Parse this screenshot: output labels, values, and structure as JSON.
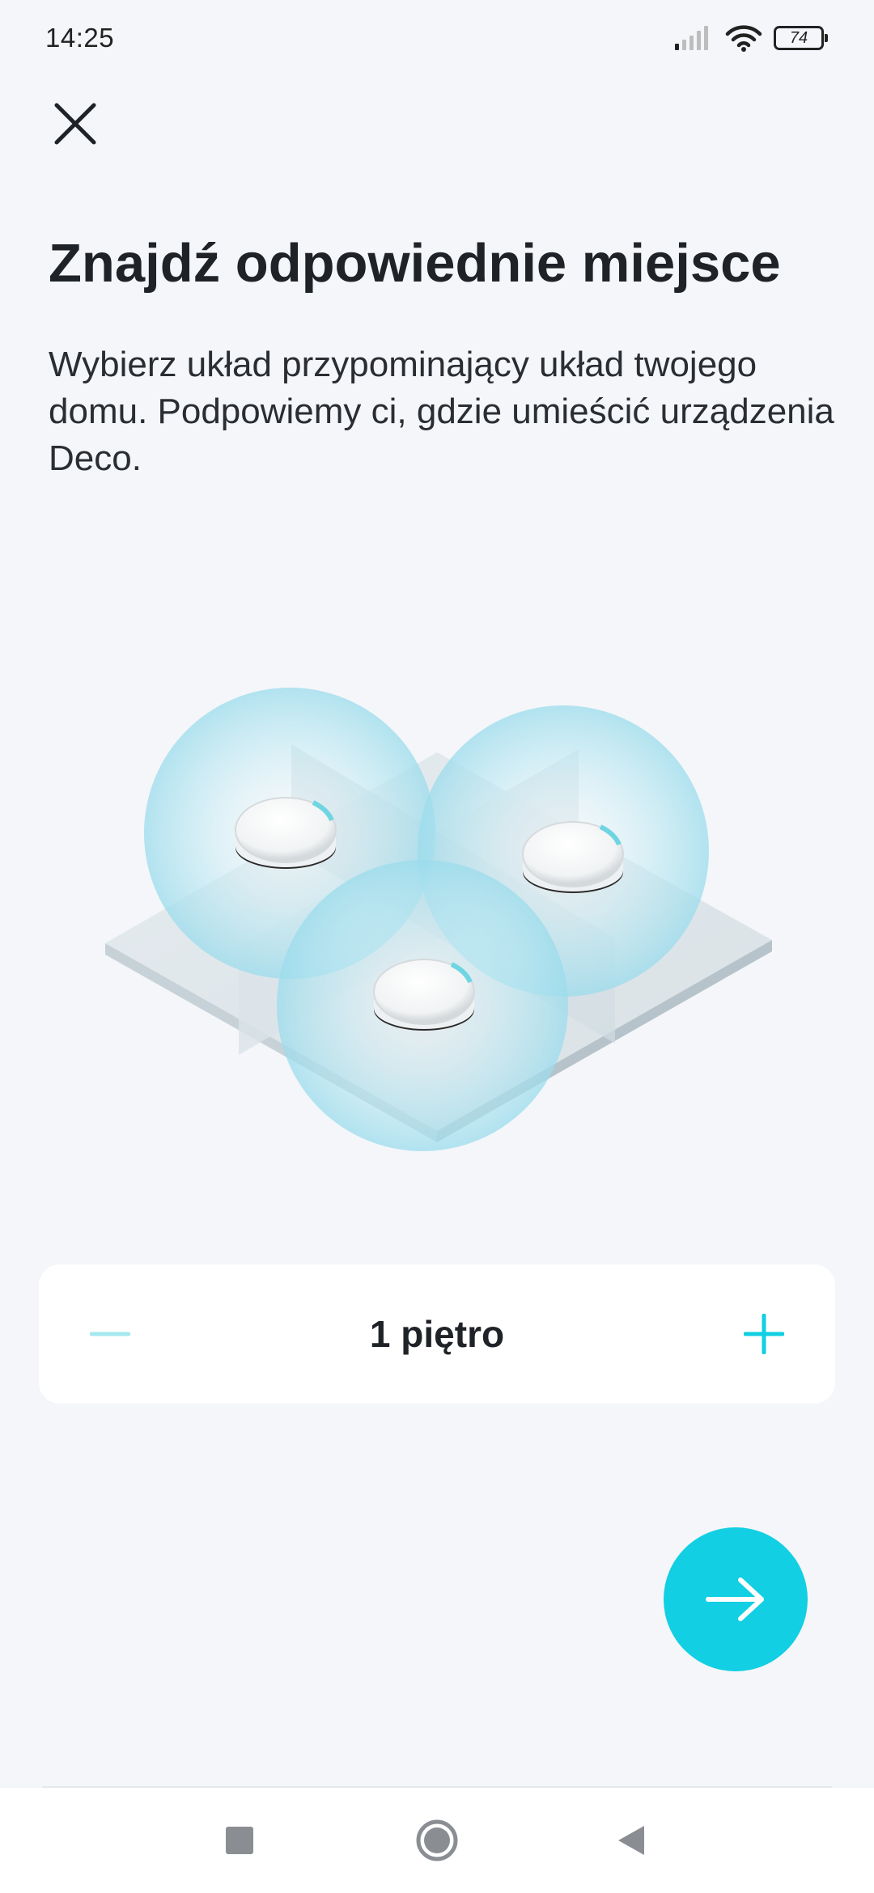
{
  "status_bar": {
    "time": "14:25",
    "battery_level": "74",
    "icons": [
      "signal-icon",
      "wifi-icon",
      "battery-icon"
    ]
  },
  "header": {
    "close_icon": "close-icon"
  },
  "main": {
    "title": "Znajdź odpowiednie miejsce",
    "description": "Wybierz układ przypominający układ twojego domu. Podpowiemy ci, gdzie umieścić urządzenia Deco.",
    "illustration_icon": "deco-floor-plan-illustration"
  },
  "floor_selector": {
    "value_label": "1 piętro",
    "floors": 1,
    "minus_icon": "minus-icon",
    "plus_icon": "plus-icon"
  },
  "next_button": {
    "icon": "arrow-right-icon"
  },
  "nav_bar": {
    "items": [
      "recent-apps-icon",
      "home-icon",
      "back-icon"
    ]
  },
  "colors": {
    "accent": "#12cfe3",
    "background": "#f4f6f9",
    "card": "#ffffff",
    "text": "#1f2328",
    "minus_disabled": "#a6e8ef"
  }
}
